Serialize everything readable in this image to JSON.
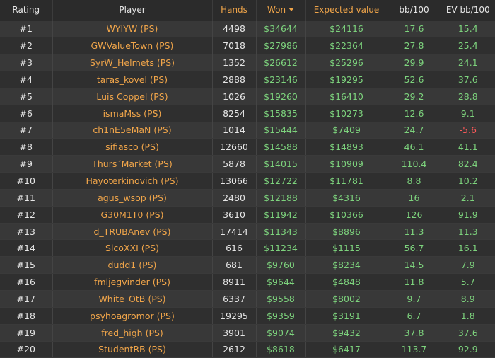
{
  "headers": {
    "rating": "Rating",
    "player": "Player",
    "hands": "Hands",
    "won": "Won",
    "expected": "Expected value",
    "bb100": "bb/100",
    "evbb100": "EV bb/100"
  },
  "colors": {
    "accent": "#f0a54a",
    "positive": "#7dd37d",
    "negative": "#ff5a5a",
    "background": "#2b2b2b"
  },
  "rows": [
    {
      "rating": "#1",
      "player": "WYIYW (PS)",
      "hands": "4498",
      "won": "$34644",
      "ev": "$24116",
      "bb": "17.6",
      "evbb": "15.4"
    },
    {
      "rating": "#2",
      "player": "GWValueTown (PS)",
      "hands": "7018",
      "won": "$27986",
      "ev": "$22364",
      "bb": "27.8",
      "evbb": "25.4"
    },
    {
      "rating": "#3",
      "player": "SyrW_Helmets (PS)",
      "hands": "1352",
      "won": "$26612",
      "ev": "$25296",
      "bb": "29.9",
      "evbb": "24.1"
    },
    {
      "rating": "#4",
      "player": "taras_kovel (PS)",
      "hands": "2888",
      "won": "$23146",
      "ev": "$19295",
      "bb": "52.6",
      "evbb": "37.6"
    },
    {
      "rating": "#5",
      "player": "Luis Coppel (PS)",
      "hands": "1026",
      "won": "$19260",
      "ev": "$16410",
      "bb": "29.2",
      "evbb": "28.8"
    },
    {
      "rating": "#6",
      "player": "ismaMss (PS)",
      "hands": "8254",
      "won": "$15835",
      "ev": "$10273",
      "bb": "12.6",
      "evbb": "9.1"
    },
    {
      "rating": "#7",
      "player": "ch1nE5eMaN (PS)",
      "hands": "1014",
      "won": "$15444",
      "ev": "$7409",
      "bb": "24.7",
      "evbb": "-5.6"
    },
    {
      "rating": "#8",
      "player": "sifiasco (PS)",
      "hands": "12660",
      "won": "$14588",
      "ev": "$14893",
      "bb": "46.1",
      "evbb": "41.1"
    },
    {
      "rating": "#9",
      "player": "Thurs´Market (PS)",
      "hands": "5878",
      "won": "$14015",
      "ev": "$10909",
      "bb": "110.4",
      "evbb": "82.4"
    },
    {
      "rating": "#10",
      "player": "Hayoterkinovich (PS)",
      "hands": "13066",
      "won": "$12722",
      "ev": "$11781",
      "bb": "8.8",
      "evbb": "10.2"
    },
    {
      "rating": "#11",
      "player": "agus_wsop (PS)",
      "hands": "2480",
      "won": "$12188",
      "ev": "$4316",
      "bb": "16",
      "evbb": "2.1"
    },
    {
      "rating": "#12",
      "player": "G30M1T0 (PS)",
      "hands": "3610",
      "won": "$11942",
      "ev": "$10366",
      "bb": "126",
      "evbb": "91.9"
    },
    {
      "rating": "#13",
      "player": "d_TRUBAnev (PS)",
      "hands": "17414",
      "won": "$11343",
      "ev": "$8896",
      "bb": "11.3",
      "evbb": "11.3"
    },
    {
      "rating": "#14",
      "player": "SicoXXI (PS)",
      "hands": "616",
      "won": "$11234",
      "ev": "$1115",
      "bb": "56.7",
      "evbb": "16.1"
    },
    {
      "rating": "#15",
      "player": "dudd1 (PS)",
      "hands": "681",
      "won": "$9760",
      "ev": "$8234",
      "bb": "14.5",
      "evbb": "7.9"
    },
    {
      "rating": "#16",
      "player": "fmljegvinder (PS)",
      "hands": "8911",
      "won": "$9644",
      "ev": "$4848",
      "bb": "11.8",
      "evbb": "5.7"
    },
    {
      "rating": "#17",
      "player": "White_OtB (PS)",
      "hands": "6337",
      "won": "$9558",
      "ev": "$8002",
      "bb": "9.7",
      "evbb": "8.9"
    },
    {
      "rating": "#18",
      "player": "psyhoagromor (PS)",
      "hands": "19295",
      "won": "$9359",
      "ev": "$3191",
      "bb": "6.7",
      "evbb": "1.8"
    },
    {
      "rating": "#19",
      "player": "fred_high (PS)",
      "hands": "3901",
      "won": "$9074",
      "ev": "$9432",
      "bb": "37.8",
      "evbb": "37.6"
    },
    {
      "rating": "#20",
      "player": "StudentRB (PS)",
      "hands": "2612",
      "won": "$8618",
      "ev": "$6417",
      "bb": "113.7",
      "evbb": "92.9"
    }
  ]
}
